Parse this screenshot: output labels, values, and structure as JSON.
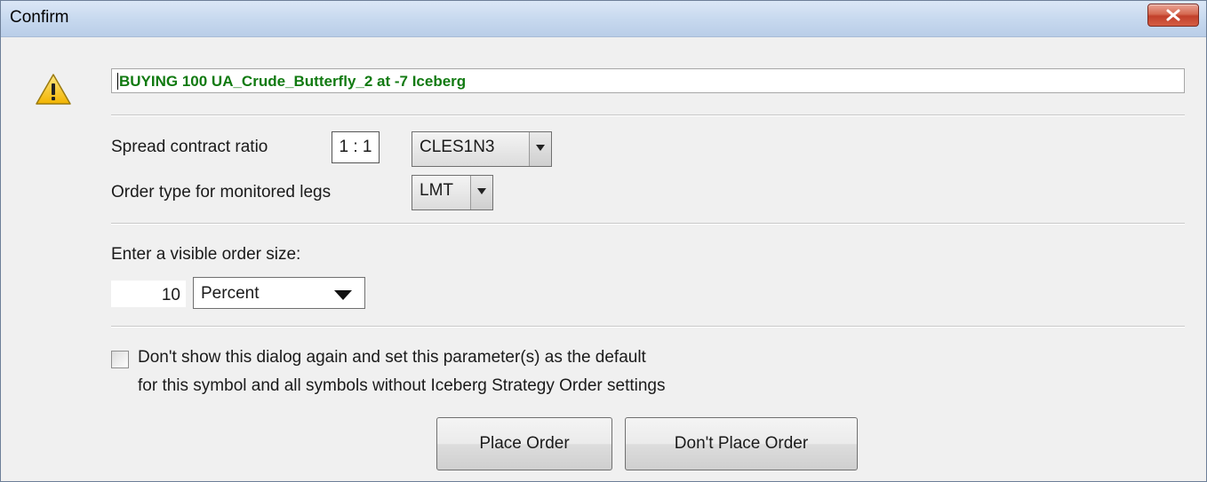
{
  "window": {
    "title": "Confirm",
    "close_icon": "close-x-icon",
    "close_color": "#c2402b"
  },
  "warning": {
    "icon": "warning-triangle-icon",
    "message": "BUYING 100 UA_Crude_Butterfly_2 at -7 Iceberg",
    "message_color": "#117a11"
  },
  "spread": {
    "ratio_label": "Spread contract ratio",
    "ratio_value": "1 : 1",
    "contract_selected": "CLES1N3",
    "order_type_label": "Order type for monitored legs",
    "order_type_selected": "LMT"
  },
  "visible_size": {
    "label": "Enter a visible order size:",
    "value": "10",
    "unit_selected": "Percent"
  },
  "default_option": {
    "checked": false,
    "line1": "Don't show this dialog again and set this parameter(s) as the default",
    "line2": "for this symbol and all symbols without Iceberg Strategy Order settings"
  },
  "buttons": {
    "place": "Place Order",
    "dont_place": "Don't Place Order"
  }
}
